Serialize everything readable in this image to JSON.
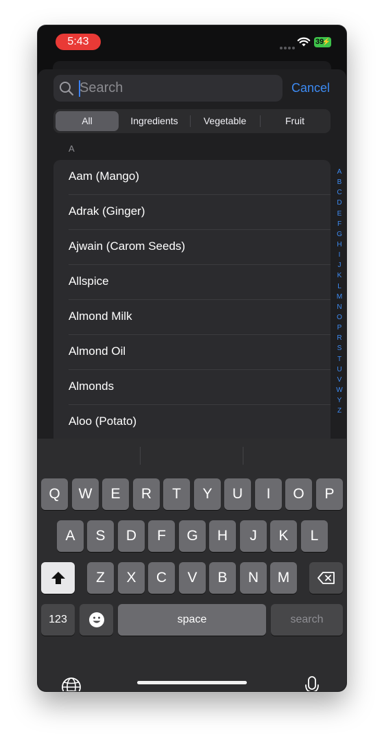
{
  "status_bar": {
    "time": "5:43",
    "battery": "39"
  },
  "search": {
    "placeholder": "Search",
    "value": "",
    "cancel_label": "Cancel"
  },
  "segments": [
    "All",
    "Ingredients",
    "Vegetable",
    "Fruit"
  ],
  "selected_segment": "All",
  "section": {
    "header": "A"
  },
  "items": [
    "Aam (Mango)",
    "Adrak (Ginger)",
    "Ajwain (Carom Seeds)",
    "Allspice",
    "Almond Milk",
    "Almond Oil",
    "Almonds",
    "Aloo (Potato)"
  ],
  "index_letters": [
    "A",
    "B",
    "C",
    "D",
    "E",
    "F",
    "G",
    "H",
    "I",
    "J",
    "K",
    "L",
    "M",
    "N",
    "O",
    "P",
    "R",
    "S",
    "T",
    "U",
    "V",
    "W",
    "Y",
    "Z"
  ],
  "keyboard": {
    "row1": [
      "Q",
      "W",
      "E",
      "R",
      "T",
      "Y",
      "U",
      "I",
      "O",
      "P"
    ],
    "row2": [
      "A",
      "S",
      "D",
      "F",
      "G",
      "H",
      "J",
      "K",
      "L"
    ],
    "row3": [
      "Z",
      "X",
      "C",
      "V",
      "B",
      "N",
      "M"
    ],
    "numbers_label": "123",
    "space_label": "space",
    "search_label": "search"
  },
  "colors": {
    "accent": "#3d8bf3",
    "time_pill": "#e93a36",
    "battery": "#3ec24a"
  },
  "icons": [
    "search-icon",
    "wifi-icon",
    "shift-icon",
    "delete-icon",
    "emoji-icon",
    "globe-icon",
    "mic-icon"
  ]
}
